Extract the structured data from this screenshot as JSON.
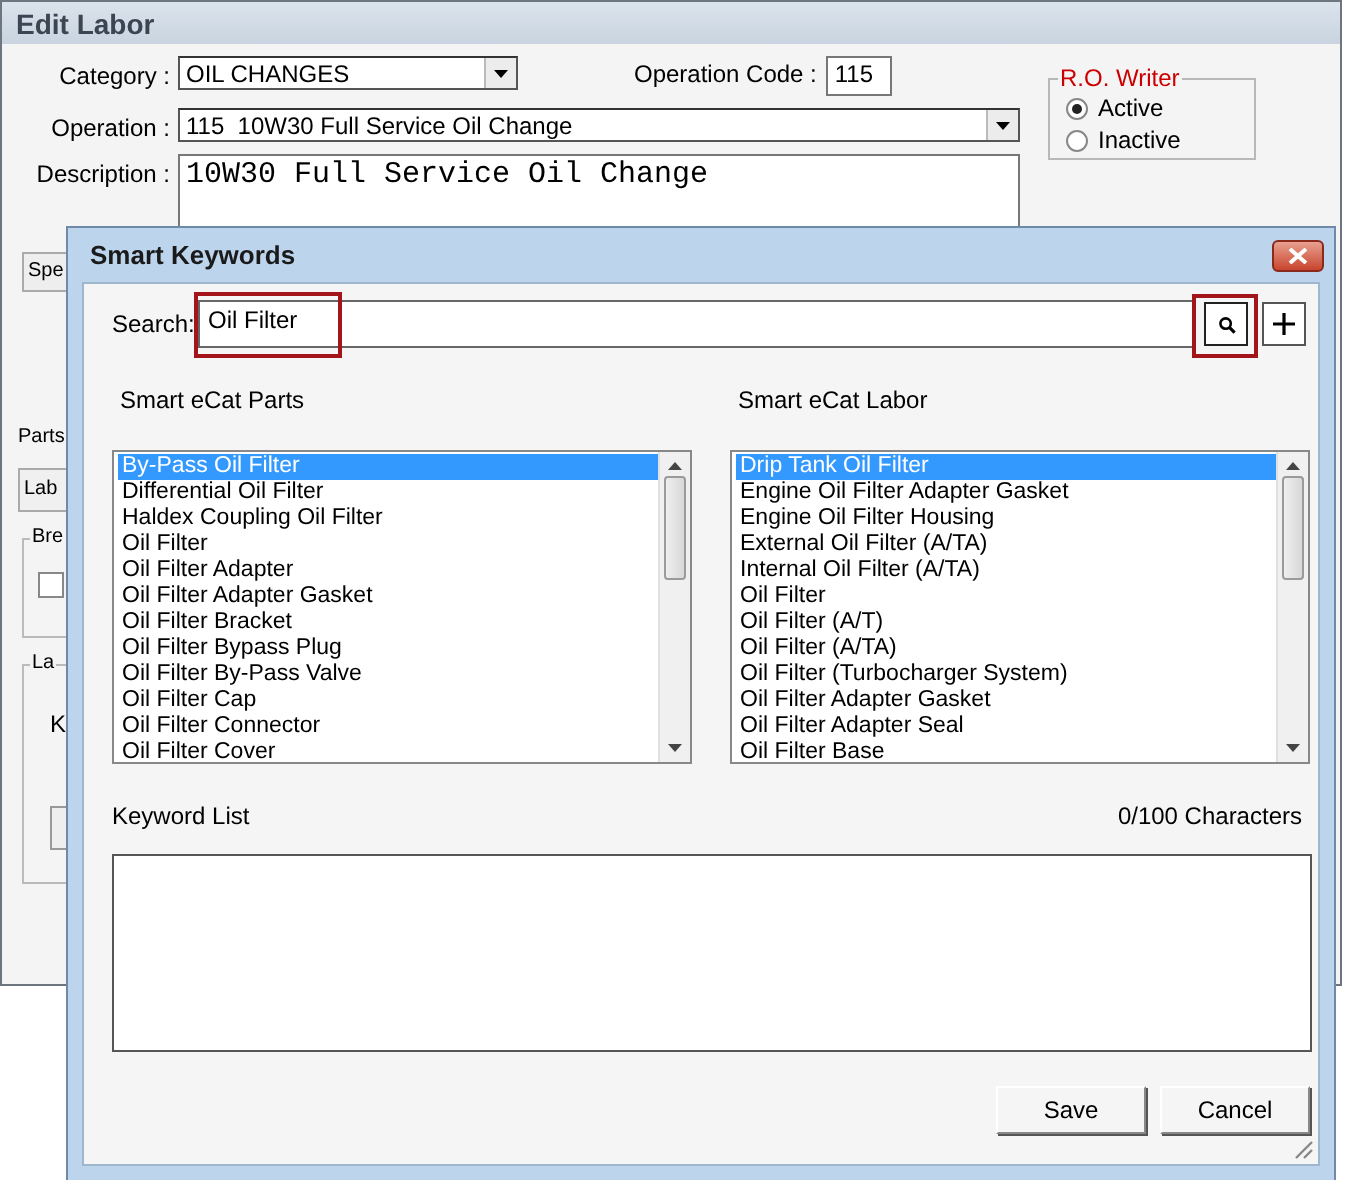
{
  "background_window": {
    "title": "Edit Labor",
    "category": {
      "label": "Category :",
      "value": "OIL CHANGES"
    },
    "operation_code": {
      "label": "Operation Code :",
      "value": "115"
    },
    "operation": {
      "label": "Operation :",
      "value": "115  10W30 Full Service Oil Change"
    },
    "description": {
      "label": "Description :",
      "value": "10W30 Full Service Oil Change"
    },
    "ro_writer": {
      "title": "R.O. Writer",
      "options": [
        {
          "label": "Active",
          "selected": true
        },
        {
          "label": "Inactive",
          "selected": false
        }
      ]
    },
    "partial": {
      "button": "Spe",
      "parts_label": "Parts",
      "tab": "Lab",
      "group_1": "Bre",
      "group_1_checked": false,
      "group_2": "La",
      "group_2_label": "K"
    }
  },
  "dialog": {
    "title": "Smart Keywords",
    "search": {
      "label": "Search:",
      "value": "Oil Filter"
    },
    "lists": [
      {
        "title": "Smart eCat Parts",
        "items": [
          {
            "label": "By-Pass Oil Filter",
            "selected": true
          },
          {
            "label": "Differential Oil Filter",
            "selected": false
          },
          {
            "label": "Haldex Coupling Oil Filter",
            "selected": false
          },
          {
            "label": "Oil Filter",
            "selected": false
          },
          {
            "label": "Oil Filter Adapter",
            "selected": false
          },
          {
            "label": "Oil Filter Adapter Gasket",
            "selected": false
          },
          {
            "label": "Oil Filter Bracket",
            "selected": false
          },
          {
            "label": "Oil Filter Bypass Plug",
            "selected": false
          },
          {
            "label": "Oil Filter By-Pass Valve",
            "selected": false
          },
          {
            "label": "Oil Filter Cap",
            "selected": false
          },
          {
            "label": "Oil Filter Connector",
            "selected": false
          },
          {
            "label": "Oil Filter Cover",
            "selected": false
          }
        ]
      },
      {
        "title": "Smart eCat Labor",
        "items": [
          {
            "label": "Drip Tank Oil Filter",
            "selected": true
          },
          {
            "label": "Engine Oil Filter Adapter Gasket",
            "selected": false
          },
          {
            "label": "Engine Oil Filter Housing",
            "selected": false
          },
          {
            "label": "External Oil Filter (A/TA)",
            "selected": false
          },
          {
            "label": "Internal Oil Filter (A/TA)",
            "selected": false
          },
          {
            "label": "Oil Filter",
            "selected": false
          },
          {
            "label": "Oil Filter (A/T)",
            "selected": false
          },
          {
            "label": "Oil Filter (A/TA)",
            "selected": false
          },
          {
            "label": "Oil Filter (Turbocharger System)",
            "selected": false
          },
          {
            "label": "Oil Filter Adapter Gasket",
            "selected": false
          },
          {
            "label": "Oil Filter Adapter Seal",
            "selected": false
          },
          {
            "label": "Oil Filter Base",
            "selected": false
          }
        ]
      }
    ],
    "keyword_list": {
      "label": "Keyword List",
      "counter": "0/100 Characters"
    },
    "buttons": [
      "Save",
      "Cancel"
    ]
  }
}
